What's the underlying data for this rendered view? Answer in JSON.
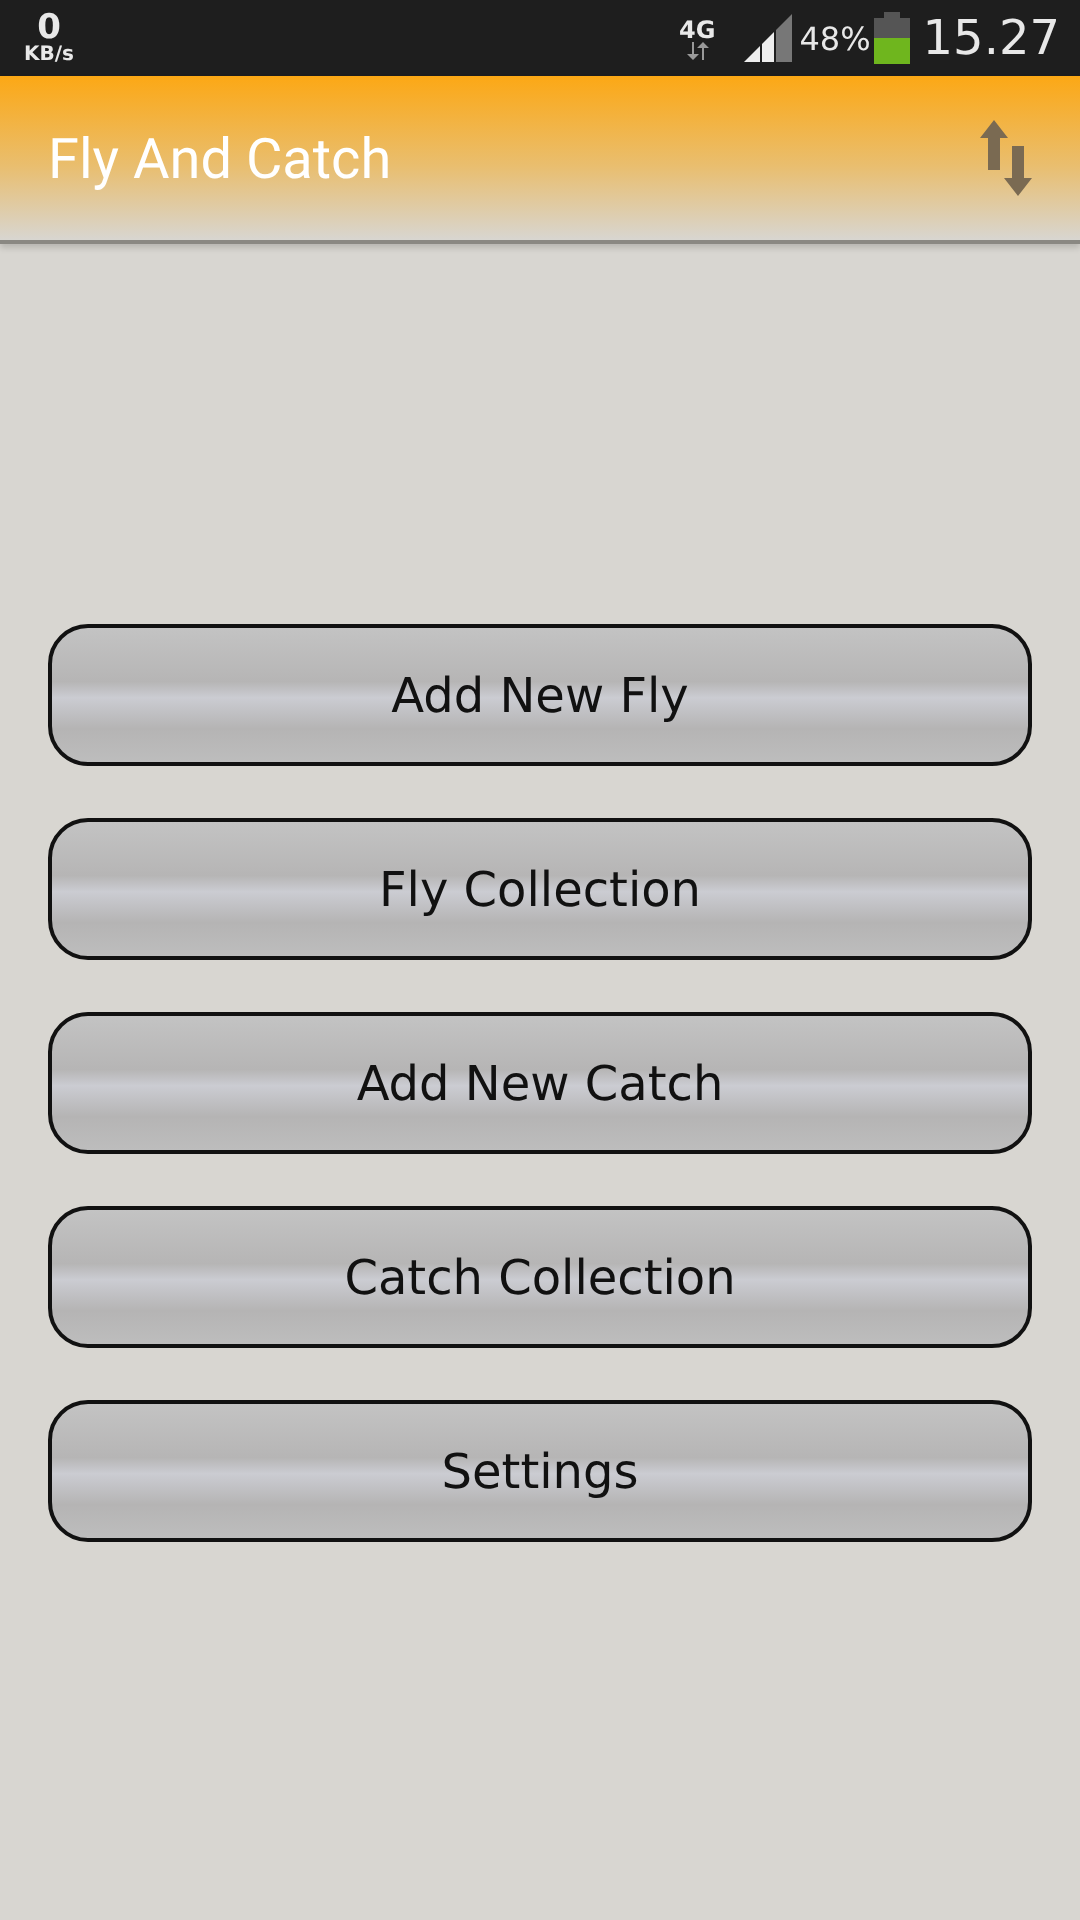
{
  "status_bar": {
    "speed": "0",
    "speed_unit": "KB/s",
    "network": "4G",
    "battery": "48%",
    "time": "15.27"
  },
  "app_bar": {
    "title": "Fly And Catch"
  },
  "buttons": [
    {
      "label": "Add New Fly"
    },
    {
      "label": "Fly Collection"
    },
    {
      "label": "Add New Catch"
    },
    {
      "label": "Catch Collection"
    },
    {
      "label": "Settings"
    }
  ]
}
